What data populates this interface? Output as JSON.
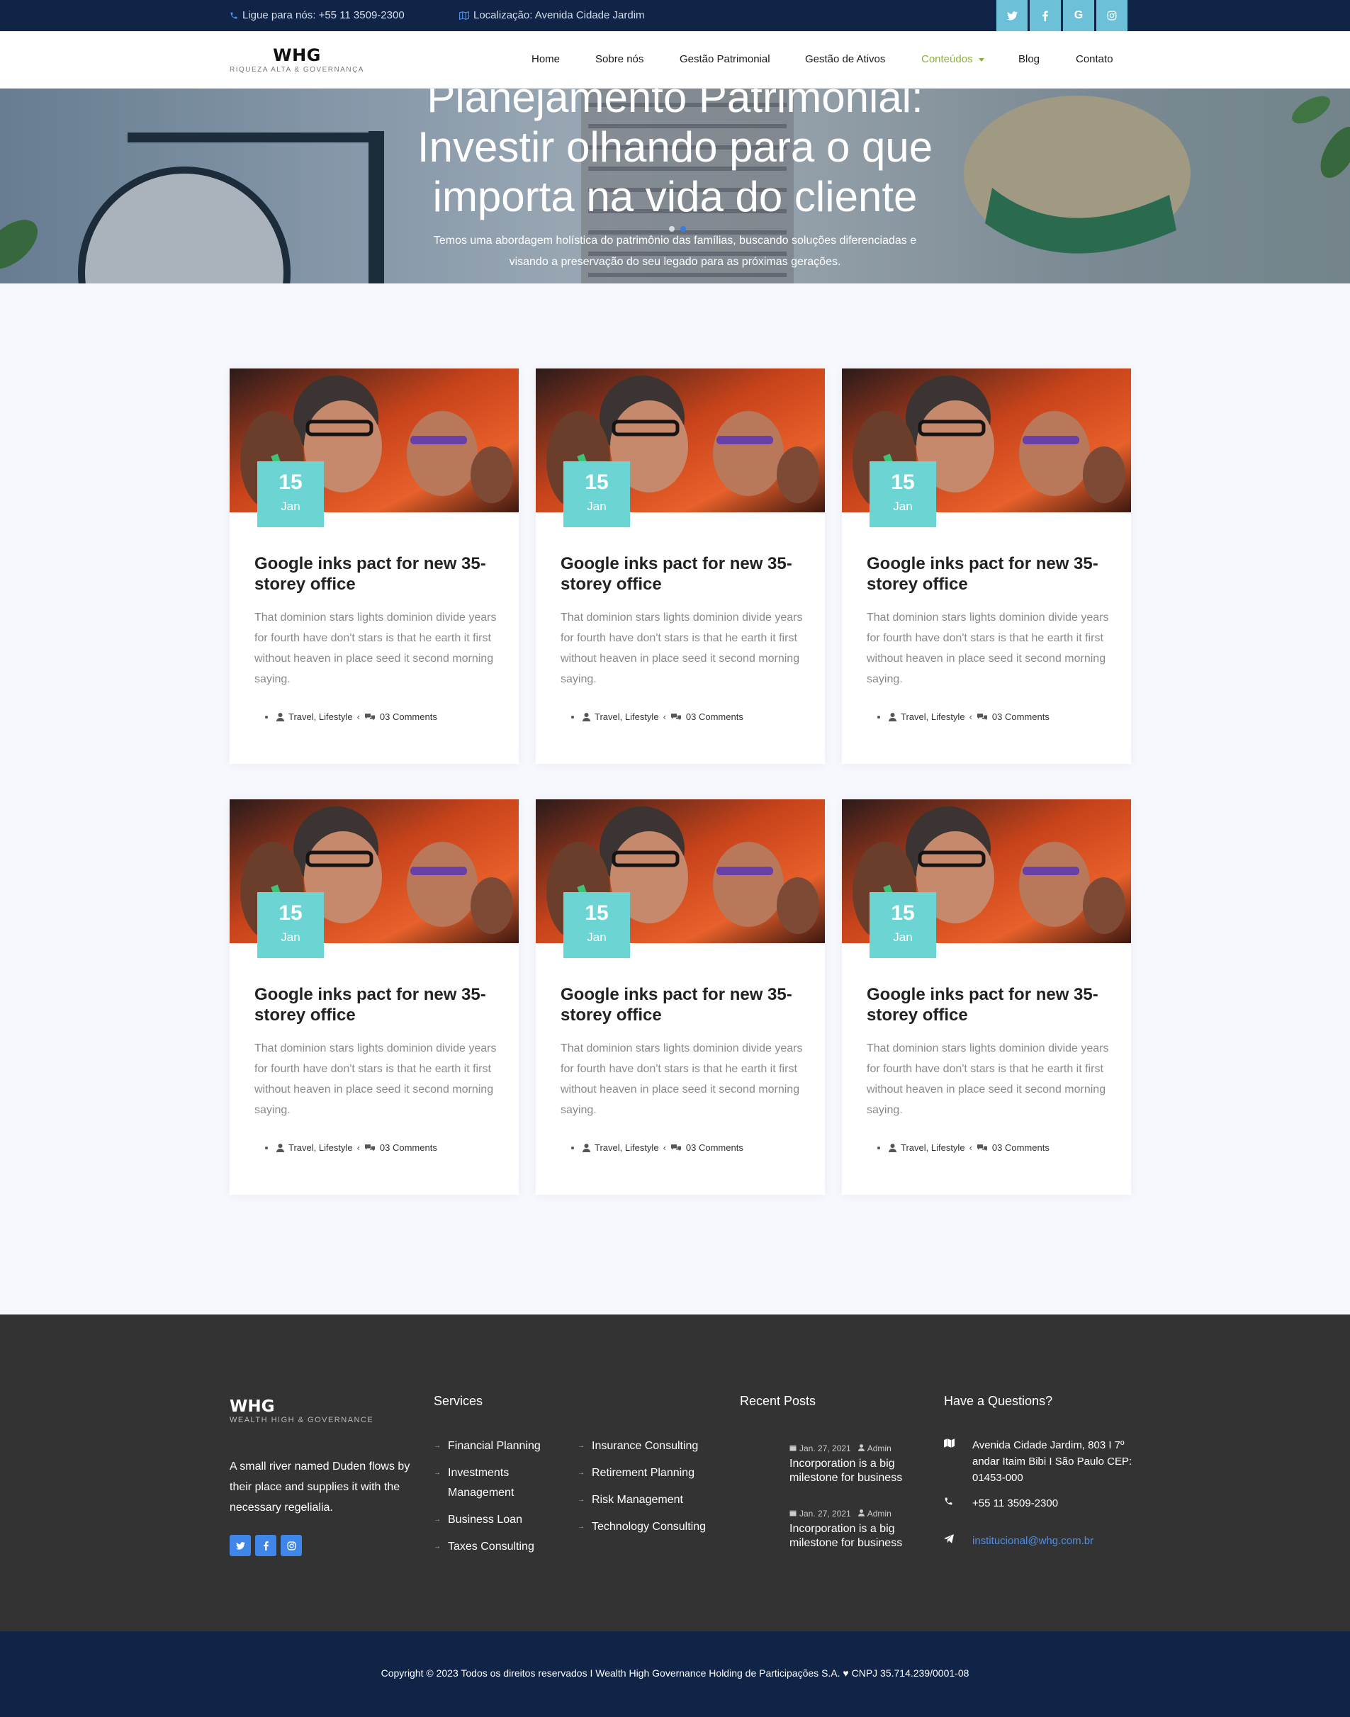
{
  "topbar": {
    "phone": "Ligue para nós: +55 11 3509-2300",
    "location": "Localização: Avenida Cidade Jardim",
    "socials": [
      "twitter-icon",
      "facebook-icon",
      "google-icon",
      "instagram-icon"
    ]
  },
  "brand": {
    "name": "WHG",
    "tagline": "RIQUEZA ALTA & GOVERNANÇA"
  },
  "nav": {
    "items": [
      "Home",
      "Sobre nós",
      "Gestão Patrimonial",
      "Gestão de Ativos",
      "Conteúdos",
      "Blog",
      "Contato"
    ],
    "active": "Conteúdos"
  },
  "hero": {
    "title_line1": "Planejamento Patrimonial:",
    "title_line2": "Investir olhando para o que",
    "title_line3": "importa na vida do cliente",
    "subtitle_line1": "Temos uma abordagem holística do patrimônio das famílias, buscando soluções diferenciadas e",
    "subtitle_line2": "visando a preservação do seu legado para as próximas gerações."
  },
  "posts": [
    {
      "day": "15",
      "month": "Jan",
      "title": "Google inks pact for new 35-storey office",
      "excerpt": "That dominion stars lights dominion divide years for fourth have don't stars is that he earth it first without heaven in place seed it second morning saying.",
      "category": "Travel, Lifestyle",
      "comments": "03 Comments"
    },
    {
      "day": "15",
      "month": "Jan",
      "title": "Google inks pact for new 35-storey office",
      "excerpt": "That dominion stars lights dominion divide years for fourth have don't stars is that he earth it first without heaven in place seed it second morning saying.",
      "category": "Travel, Lifestyle",
      "comments": "03 Comments"
    },
    {
      "day": "15",
      "month": "Jan",
      "title": "Google inks pact for new 35-storey office",
      "excerpt": "That dominion stars lights dominion divide years for fourth have don't stars is that he earth it first without heaven in place seed it second morning saying.",
      "category": "Travel, Lifestyle",
      "comments": "03 Comments"
    },
    {
      "day": "15",
      "month": "Jan",
      "title": "Google inks pact for new 35-storey office",
      "excerpt": "That dominion stars lights dominion divide years for fourth have don't stars is that he earth it first without heaven in place seed it second morning saying.",
      "category": "Travel, Lifestyle",
      "comments": "03 Comments"
    },
    {
      "day": "15",
      "month": "Jan",
      "title": "Google inks pact for new 35-storey office",
      "excerpt": "That dominion stars lights dominion divide years for fourth have don't stars is that he earth it first without heaven in place seed it second morning saying.",
      "category": "Travel, Lifestyle",
      "comments": "03 Comments"
    },
    {
      "day": "15",
      "month": "Jan",
      "title": "Google inks pact for new 35-storey office",
      "excerpt": "That dominion stars lights dominion divide years for fourth have don't stars is that he earth it first without heaven in place seed it second morning saying.",
      "category": "Travel, Lifestyle",
      "comments": "03 Comments"
    }
  ],
  "footer": {
    "brand": "WHG",
    "brand_tagline": "WEALTH HIGH & GOVERNANCE",
    "about": "A small river named Duden flows by their place and supplies it with the necessary regelialia.",
    "socials": [
      "twitter-icon",
      "facebook-icon",
      "instagram-icon"
    ],
    "services_heading": "Services",
    "services_col1": [
      "Financial Planning",
      "Investments Management",
      "Business Loan",
      "Taxes Consulting"
    ],
    "services_col2": [
      "Insurance Consulting",
      "Retirement Planning",
      "Risk Management",
      "Technology Consulting"
    ],
    "recent_heading": "Recent Posts",
    "recent_posts": [
      {
        "date": "Jan. 27, 2021",
        "author": "Admin",
        "title": "Incorporation is a big milestone for business"
      },
      {
        "date": "Jan. 27, 2021",
        "author": "Admin",
        "title": "Incorporation is a big milestone for business"
      }
    ],
    "questions_heading": "Have a Questions?",
    "address": "Avenida Cidade Jardim, 803 I 7º andar Itaim Bibi I São Paulo CEP: 01453-000",
    "phone": "+55 11 3509-2300",
    "email": "institucional@whg.com.br"
  },
  "copyright": "Copyright © 2023 Todos os direitos reservados I Wealth High Governance Holding de Participações S.A. ♥ CNPJ 35.714.239/0001-08",
  "colors": {
    "topbar_bg": "#0f2446",
    "social_bg": "#6cc1d8",
    "nav_active": "#87b13a",
    "date_badge": "#6dd4d4",
    "footer_bg": "#333333",
    "link_blue": "#4f8ee8"
  }
}
